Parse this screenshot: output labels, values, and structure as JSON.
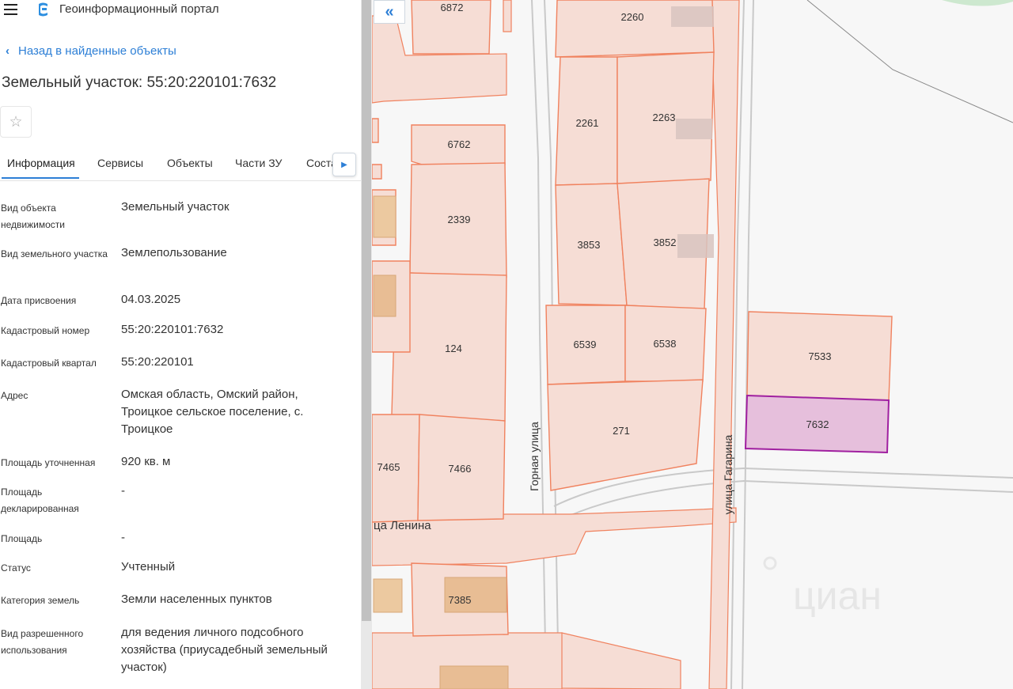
{
  "header": {
    "app_title": "Геоинформационный портал",
    "menu_icon": "hamburger-icon",
    "logo_icon": "portal-logo-icon"
  },
  "nav": {
    "back_label": "Назад в найденные объекты"
  },
  "object": {
    "title": "Земельный участок: 55:20:220101:7632"
  },
  "tabs": [
    {
      "label": "Информация",
      "active": true
    },
    {
      "label": "Сервисы"
    },
    {
      "label": "Объекты"
    },
    {
      "label": "Части ЗУ"
    },
    {
      "label": "Соста"
    }
  ],
  "info": [
    {
      "label": "Вид объекта недвижимости",
      "value": "Земельный участок"
    },
    {
      "label": "Вид земельного участка",
      "value": "Землепользование"
    },
    {
      "label": "Дата присвоения",
      "value": "04.03.2025"
    },
    {
      "label": "Кадастровый номер",
      "value": "55:20:220101:7632"
    },
    {
      "label": "Кадастровый квартал",
      "value": "55:20:220101"
    },
    {
      "label": "Адрес",
      "value": "Омская область, Омский район, Троицкое сельское поселение, с. Троицкое"
    },
    {
      "label": "Площадь уточненная",
      "value": "920 кв. м"
    },
    {
      "label": "Площадь декларированная",
      "value": "-"
    },
    {
      "label": "Площадь",
      "value": "-"
    },
    {
      "label": "Статус",
      "value": "Учтенный"
    },
    {
      "label": "Категория земель",
      "value": "Земли населенных пунктов"
    },
    {
      "label": "Вид разрешенного использования",
      "value": "для ведения личного подсобного хозяйства (приусадебный земельный участок)"
    }
  ],
  "map": {
    "collapse_icon": "double-chevron-left-icon",
    "parcel_labels": [
      "6872",
      "2260",
      "2261",
      "2263",
      "6762",
      "2339",
      "3853",
      "3852",
      "124",
      "6539",
      "6538",
      "7533",
      "7632",
      "271",
      "7465",
      "7466",
      "7385"
    ],
    "streets": {
      "gornaya": "Горная улица",
      "gagarina": "улица Гагарина",
      "lenina": "ца Ленина"
    },
    "watermark": "циан",
    "colors": {
      "parcel_fill": "#f6ddd5",
      "parcel_stroke": "#f0825f",
      "selected_fill": "#e6bfdc",
      "selected_stroke": "#a020a0",
      "building": "#e8bd94"
    }
  }
}
